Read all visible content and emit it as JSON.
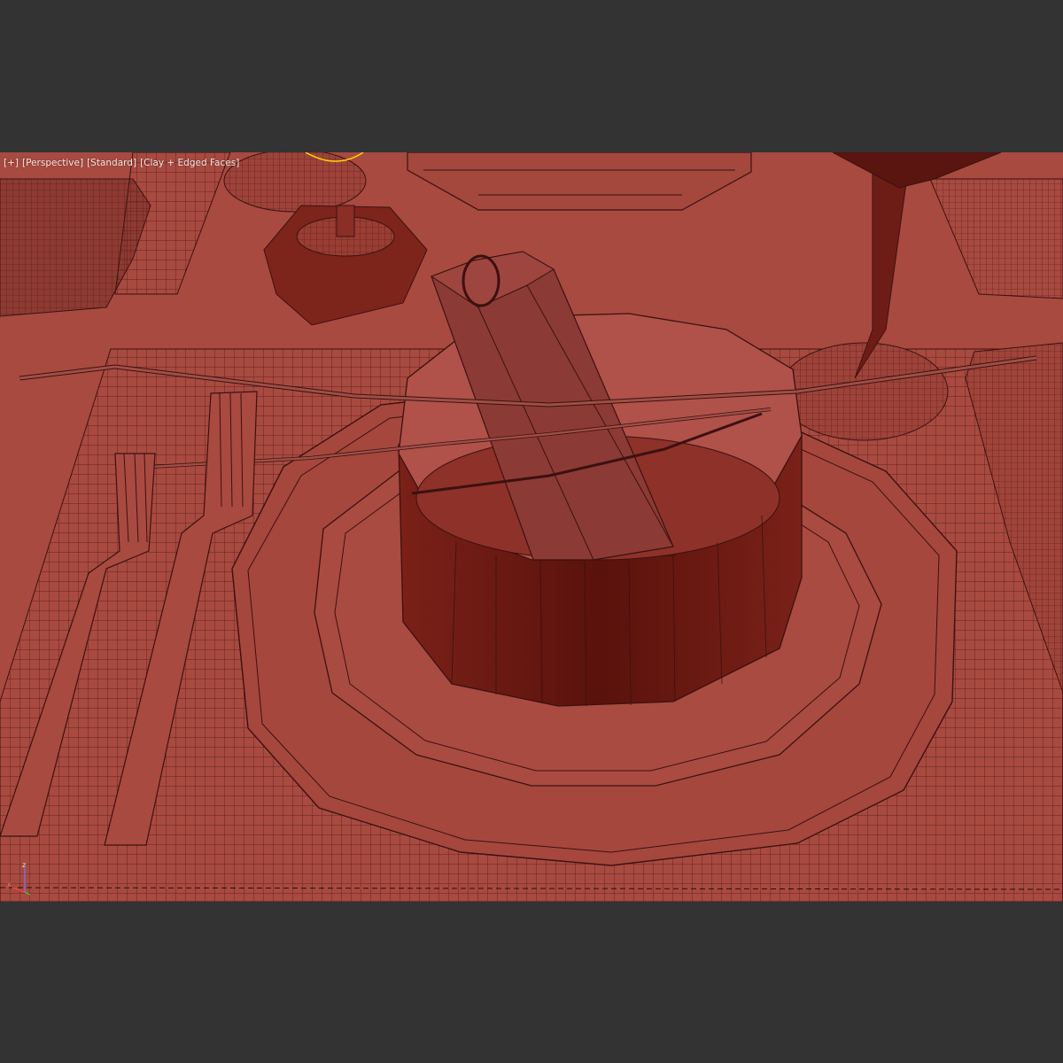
{
  "viewport": {
    "labels": [
      "+",
      "Perspective",
      "Standard",
      "Clay + Edged Faces"
    ],
    "shading_color": "#a84a40",
    "wire_color": "#3a1210",
    "background_color": "#333333",
    "selection_color": "#ffd400"
  },
  "gizmo": {
    "axis_z": "z",
    "axis_x": "x"
  },
  "scene_objects": [
    "placemat",
    "fork-left",
    "fork-right",
    "charger-plate",
    "dinner-plate",
    "bowl",
    "name-tag",
    "twig-branch",
    "wine-glass",
    "napkin-left",
    "napkin-right",
    "napkin-back-right",
    "candle-holder",
    "tray"
  ]
}
